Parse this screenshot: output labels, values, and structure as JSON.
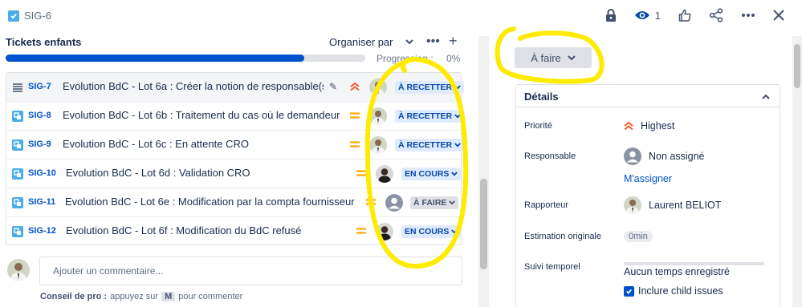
{
  "header": {
    "issue_key": "SIG-6",
    "watch_count": "1"
  },
  "children": {
    "title": "Tickets enfants",
    "order_label": "Organiser par",
    "progress_label": "Progression :",
    "progress_pct": "0%",
    "progress_fraction": 0.83,
    "rows": [
      {
        "key": "SIG-7",
        "summary": "Evolution BdC - Lot 6a : Créer la notion de responsable(s...",
        "priority": "highest",
        "status": "À RECETTER",
        "assignee": "person"
      },
      {
        "key": "SIG-8",
        "summary": "Evolution BdC - Lot 6b : Traitement du cas où le demandeur e...",
        "priority": "medium",
        "status": "À RECETTER",
        "assignee": "person"
      },
      {
        "key": "SIG-9",
        "summary": "Evolution BdC - Lot 6c : En attente CRO",
        "priority": "medium",
        "status": "À RECETTER",
        "assignee": "person"
      },
      {
        "key": "SIG-10",
        "summary": "Evolution BdC - Lot 6d : Validation CRO",
        "priority": "medium",
        "status": "EN COURS",
        "assignee": "person"
      },
      {
        "key": "SIG-11",
        "summary": "Evolution BdC - Lot 6e : Modification par la compta fournisseur",
        "priority": "medium",
        "status": "À FAIRE",
        "assignee": "unassigned"
      },
      {
        "key": "SIG-12",
        "summary": "Evolution BdC - Lot 6f : Modification du BdC refusé",
        "priority": "medium",
        "status": "EN COURS",
        "assignee": "person"
      }
    ]
  },
  "comment": {
    "placeholder": "Ajouter un commentaire...",
    "tip_bold": "Conseil de pro :",
    "tip_text_1": "appuyez sur",
    "tip_key": "M",
    "tip_text_2": "pour commenter"
  },
  "sidebar": {
    "status_button": "À faire",
    "details_title": "Détails",
    "fields": {
      "priority_label": "Priorité",
      "priority_value": "Highest",
      "assignee_label": "Responsable",
      "assignee_value": "Non assigné",
      "assign_me": "M'assigner",
      "reporter_label": "Rapporteur",
      "reporter_value": "Laurent BELIOT",
      "estimate_label": "Estimation originale",
      "estimate_value": "0min",
      "tracking_label": "Suivi temporel",
      "tracking_value": "Aucun temps enregistré",
      "child_issues_label": "Inclure child issues"
    }
  },
  "colors": {
    "accent": "#0052cc",
    "highlight_annotation": "#ffeb00",
    "priority_highest": "#ff5630",
    "priority_medium": "#ffab00"
  }
}
